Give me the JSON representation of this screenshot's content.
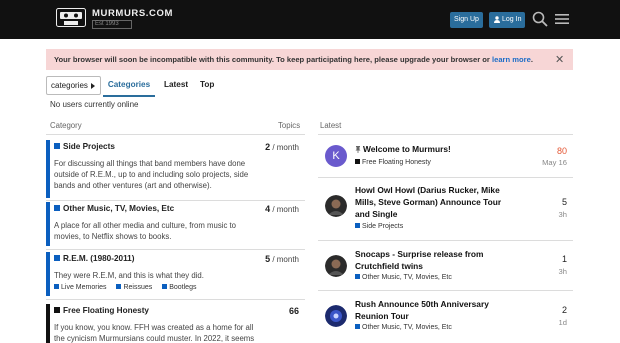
{
  "header": {
    "site_name": "MURMURS.COM",
    "site_sub": "Est 1993",
    "signup_label": "Sign Up",
    "login_label": "Log In",
    "accent": "#2a6d9c"
  },
  "alert": {
    "text": "Your browser will soon be incompatible with this community. To keep participating here, please upgrade your browser or ",
    "link": "learn more",
    "tail": ".",
    "close": "✕"
  },
  "nav": {
    "dropdown": "categories",
    "tabs": [
      "Categories",
      "Latest",
      "Top"
    ]
  },
  "online_text": "No users currently online",
  "columns": {
    "category": "Category",
    "topics": "Topics",
    "latest": "Latest"
  },
  "categories": [
    {
      "name": "Side Projects",
      "color": "#0b5fbf",
      "desc": "For discussing all things that band members have done outside of R.E.M., up to and including solo projects, side bands and other ventures (art and otherwise).",
      "count": "2",
      "unit": "/ month"
    },
    {
      "name": "Other Music, TV, Movies, Etc",
      "color": "#0b5fbf",
      "desc": "A place for all other media and culture, from music to movies, to Netflix shows to books.",
      "count": "4",
      "unit": "/ month"
    },
    {
      "name": "R.E.M. (1980-2011)",
      "color": "#0b5fbf",
      "desc": "They were R.E.M, and this is what they did.",
      "count": "5",
      "unit": "/ month",
      "subcategories": [
        "Live Memories",
        "Reissues",
        "Bootlegs"
      ]
    },
    {
      "name": "Free Floating Honesty",
      "color": "#111111",
      "desc": "If you know, you know. FFH was created as a home for all the cynicism Murmursians could muster. In 2022, it seems",
      "count": "66",
      "unit": ""
    }
  ],
  "latest": [
    {
      "title": "Welcome to Murmurs!",
      "pinned": true,
      "category": "Free Floating Honesty",
      "cat_color": "#111111",
      "posts": "80",
      "posts_color": "#e45735",
      "age": "May 16",
      "avatar_letter": "K",
      "avatar_color": "#6a5acd"
    },
    {
      "title": "Howl Owl Howl (Darius Rucker, Mike Mills, Steve Gorman) Announce Tour and Single",
      "category": "Side Projects",
      "cat_color": "#0b5fbf",
      "posts": "5",
      "age": "3h"
    },
    {
      "title": "Snocaps - Surprise release from Crutchfield twins",
      "category": "Other Music, TV, Movies, Etc",
      "cat_color": "#0b5fbf",
      "posts": "1",
      "age": "3h"
    },
    {
      "title": "Rush Announce 50th Anniversary Reunion Tour",
      "category": "Other Music, TV, Movies, Etc",
      "cat_color": "#0b5fbf",
      "posts": "2",
      "age": "1d"
    }
  ]
}
